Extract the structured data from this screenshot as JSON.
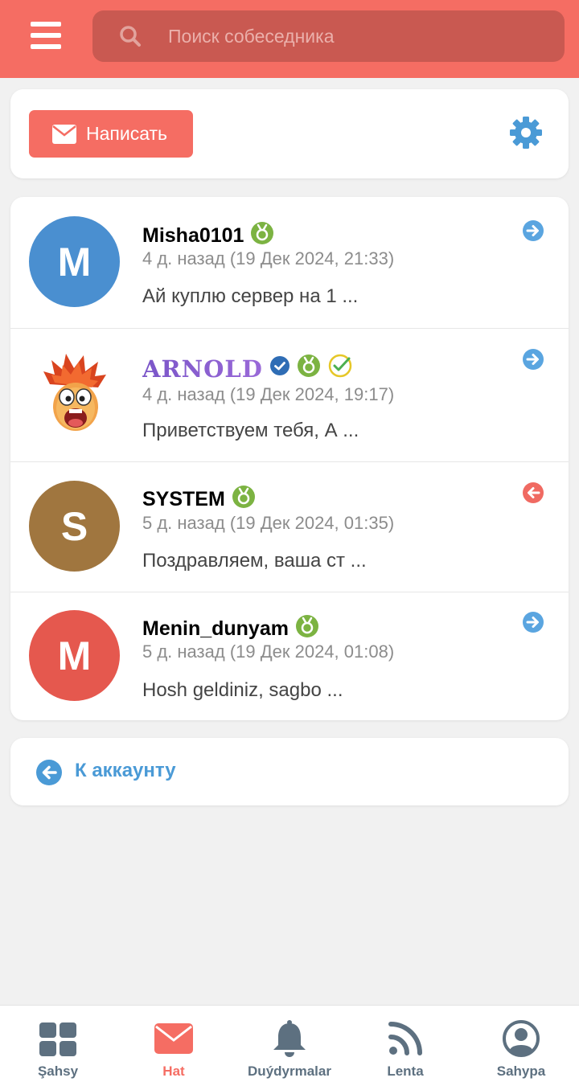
{
  "header": {
    "search_placeholder": "Поиск собеседника"
  },
  "toolbar": {
    "compose_label": "Написать"
  },
  "conversations": [
    {
      "avatar_letter": "M",
      "avatar_color": "#4a8fd0",
      "name": "Misha0101",
      "time": "4 д. назад (19 Дек 2024, 21:33)",
      "preview": "Ай куплю сервер на 1 ...",
      "direction": "outgoing"
    },
    {
      "avatar_letter": "",
      "avatar_color": "",
      "name": "ARNOLD",
      "time": "4 д. назад (19 Дек 2024, 19:17)",
      "preview": "Приветствуем тебя, А ...",
      "direction": "outgoing"
    },
    {
      "avatar_letter": "S",
      "avatar_color": "#a0763f",
      "name": "SYSTEM",
      "time": "5 д. назад (19 Дек 2024, 01:35)",
      "preview": "Поздравляем, ваша ст ...",
      "direction": "incoming"
    },
    {
      "avatar_letter": "M",
      "avatar_color": "#e5584e",
      "name": "Menin_dunyam",
      "time": "5 д. назад (19 Дек 2024, 01:08)",
      "preview": "Hosh geldiniz, sagbo ...",
      "direction": "outgoing"
    }
  ],
  "back_link": {
    "label": "К аккаунту"
  },
  "bottom_nav": [
    {
      "label": "Şahsy",
      "icon": "grid-icon",
      "active": false
    },
    {
      "label": "Hat",
      "icon": "envelope-icon",
      "active": true
    },
    {
      "label": "Duýdyrmalar",
      "icon": "bell-icon",
      "active": false
    },
    {
      "label": "Lenta",
      "icon": "rss-icon",
      "active": false
    },
    {
      "label": "Sahypa",
      "icon": "user-circle-icon",
      "active": false
    }
  ],
  "colors": {
    "accent": "#f56d63",
    "link_blue": "#4a9ad6",
    "badge_green": "#7cb342",
    "outgoing_arrow": "#5aa5e0",
    "incoming_arrow": "#f06a62",
    "nav_inactive": "#5d7080"
  }
}
